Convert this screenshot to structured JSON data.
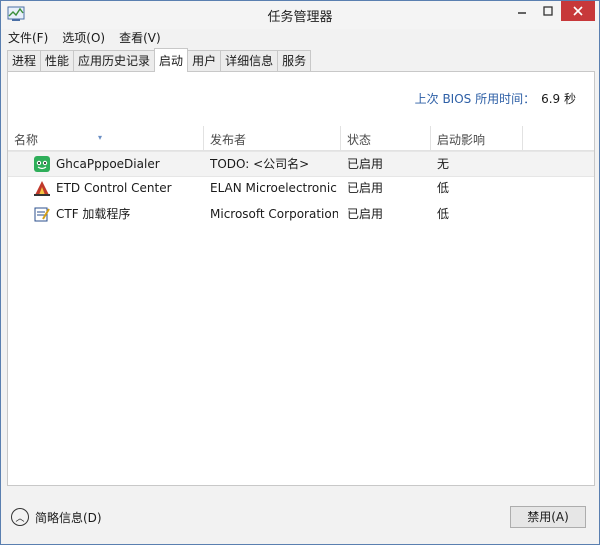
{
  "window": {
    "title": "任务管理器"
  },
  "menu": [
    {
      "label": "文件(F)"
    },
    {
      "label": "选项(O)"
    },
    {
      "label": "查看(V)"
    }
  ],
  "tabs": [
    {
      "label": "进程"
    },
    {
      "label": "性能"
    },
    {
      "label": "应用历史记录"
    },
    {
      "label": "启动",
      "active": true
    },
    {
      "label": "用户"
    },
    {
      "label": "详细信息"
    },
    {
      "label": "服务"
    }
  ],
  "bios": {
    "label": "上次 BIOS 所用时间：",
    "value": "6.9 秒"
  },
  "columns": {
    "name": "名称",
    "publisher": "发布者",
    "status": "状态",
    "impact": "启动影响"
  },
  "rows": [
    {
      "name": "GhcaPppoeDialer",
      "publisher": "TODO: <公司名>",
      "status": "已启用",
      "impact": "无",
      "icon": "ghca-dialer-icon"
    },
    {
      "name": "ETD Control Center",
      "publisher": "ELAN Microelectronic...",
      "status": "已启用",
      "impact": "低",
      "icon": "etd-control-icon"
    },
    {
      "name": "CTF 加载程序",
      "publisher": "Microsoft Corporation",
      "status": "已启用",
      "impact": "低",
      "icon": "ctf-loader-icon"
    }
  ],
  "footer": {
    "fewer_details": "简略信息(D)",
    "disable_button": "禁用(A)"
  },
  "colors": {
    "accent": "#2d5fa6",
    "close_button": "#c7383a"
  }
}
